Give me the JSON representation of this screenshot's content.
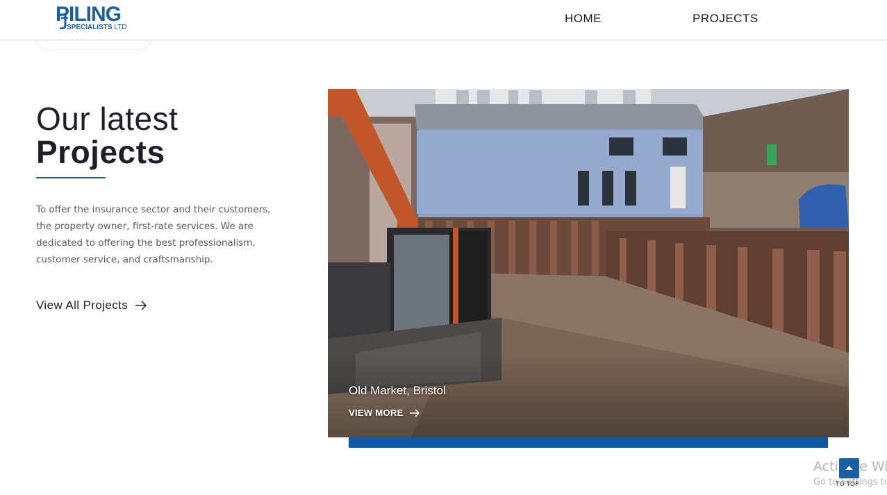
{
  "header": {
    "logo": {
      "main": "PILING",
      "sub": "SPECIALISTS",
      "ltd": "LTD"
    },
    "nav": [
      {
        "label": "HOME"
      },
      {
        "label": "PROJECTS"
      }
    ]
  },
  "intro": {
    "title_light": "Our latest",
    "title_bold": "Projects",
    "body": "To offer the insurance sector and their customers, the property owner, first-rate services. We are dedicated to offering the best professionalism, customer service, and craftsmanship.",
    "cta_label": "View All Projects"
  },
  "project_card": {
    "title": "Old Market, Bristol",
    "more_label": "VIEW MORE"
  },
  "to_top": {
    "label": "TO TOP"
  },
  "watermark": {
    "line1": "Activate Wir",
    "line2": "Go to Settings to"
  },
  "colors": {
    "brand_blue": "#1b5ea8",
    "accent_bar": "#0a5aa8",
    "text_dark": "#1d1d2c"
  }
}
